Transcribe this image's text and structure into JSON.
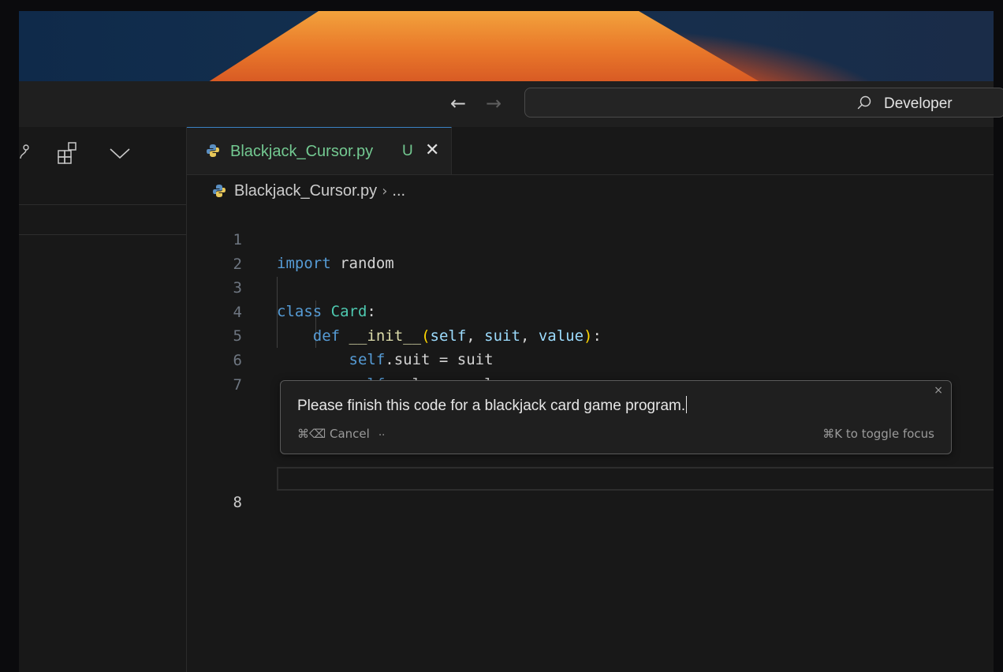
{
  "colors": {
    "accent": "#3b82c4",
    "modified": "#73c991",
    "editor_bg": "#1f1f1f"
  },
  "titlebar": {
    "back_icon": "arrow-left-icon",
    "forward_icon": "arrow-right-icon",
    "command_center": {
      "icon": "search-icon",
      "label": "Developer"
    }
  },
  "sidebar": {
    "icons": [
      "source-control-icon",
      "extensions-icon",
      "chevron-down-icon"
    ]
  },
  "tabs": [
    {
      "label": "Blackjack_Cursor.py",
      "status": "U",
      "icon": "python-icon",
      "close_icon": "close-icon"
    }
  ],
  "breadcrumb": {
    "file": "Blackjack_Cursor.py",
    "rest": "..."
  },
  "editor": {
    "lines": [
      {
        "num": "1",
        "t1": "import",
        "t2": " random"
      },
      {
        "num": "2"
      },
      {
        "num": "3",
        "t1": "class",
        "t2": " ",
        "t3": "Card",
        "t4": ":"
      },
      {
        "num": "4",
        "t0": "    ",
        "t1": "def",
        "t2": " ",
        "t3": "__init__",
        "t4": "(",
        "t5": "self",
        "t6": ", ",
        "t7": "suit",
        "t8": ", ",
        "t9": "value",
        "t10": ")",
        "t11": ":"
      },
      {
        "num": "5",
        "t0": "        ",
        "t1": "self",
        "t2": ".suit = suit"
      },
      {
        "num": "6",
        "t0": "        ",
        "t1": "self",
        "t2": ".value = value"
      },
      {
        "num": "7"
      },
      {
        "num": "8"
      }
    ]
  },
  "prompt": {
    "text": "Please finish this code for a blackjack card game program.",
    "cancel": "⌘⌫ Cancel",
    "dots": "..",
    "hint": "⌘K to toggle focus",
    "close": "×"
  }
}
